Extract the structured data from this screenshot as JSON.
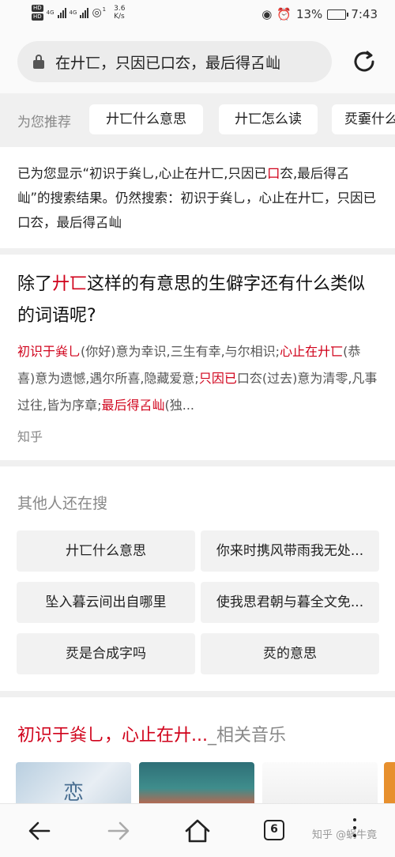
{
  "status_bar": {
    "hd1": "HD",
    "hd2": "HD",
    "net1": "4G",
    "net2": "4G",
    "speed_value": "3.6",
    "speed_unit": "K/s",
    "wifi_badge": "1",
    "battery": "13%",
    "time": "7:43"
  },
  "search": {
    "query": "在廾匸，只因已口厺，最后得叾屾"
  },
  "recommend": {
    "label": "为您推荐",
    "chips": [
      "廾匸什么意思",
      "廾匸怎么读",
      "烎嫑什么"
    ]
  },
  "notice": {
    "part1": "已为您显示“初识于烡乚,心止在廾匸,只因已",
    "red": "口",
    "part2": "厺,最后得叾屾”的搜索结果。仍然搜索：初识于烡乚，心止在廾匸，只因已口厺，最后得叾屾"
  },
  "result": {
    "title_pre": "除了",
    "title_red": "廾匸",
    "title_post": "这样的有意思的生僻字还有什么类似的词语呢?",
    "s1_red": "初识于烡乚",
    "s1": "(你好)意为幸识,三生有幸,与尔相识;",
    "s2_red": "心止在廾匸",
    "s2": "(恭喜)意为遗憾,遇尔所喜,隐藏爱意;",
    "s3_red": "只因已",
    "s3": "口厺(过去)意为清零,凡事过往,皆为序章;",
    "s4_red": "最后得叾屾",
    "s4": "(独...",
    "source": "知乎"
  },
  "others": {
    "title": "其他人还在搜",
    "items": [
      "廾匸什么意思",
      "你来时携风带雨我无处...",
      "坠入暮云间出自哪里",
      "使我思君朝与暮全文免...",
      "烎是合成字吗",
      "烎的意思"
    ]
  },
  "music": {
    "title_red": "初识于烡乚，心止在廾...",
    "title_gray": "_相关音乐",
    "thumb_text": "恋"
  },
  "nav": {
    "tab_count": "6",
    "watermark": "知乎 @蜗牛竟"
  },
  "colors": {
    "highlight_red": "#d0021b",
    "chip_bg": "#ffffff",
    "page_bg": "#f0f0f0"
  }
}
